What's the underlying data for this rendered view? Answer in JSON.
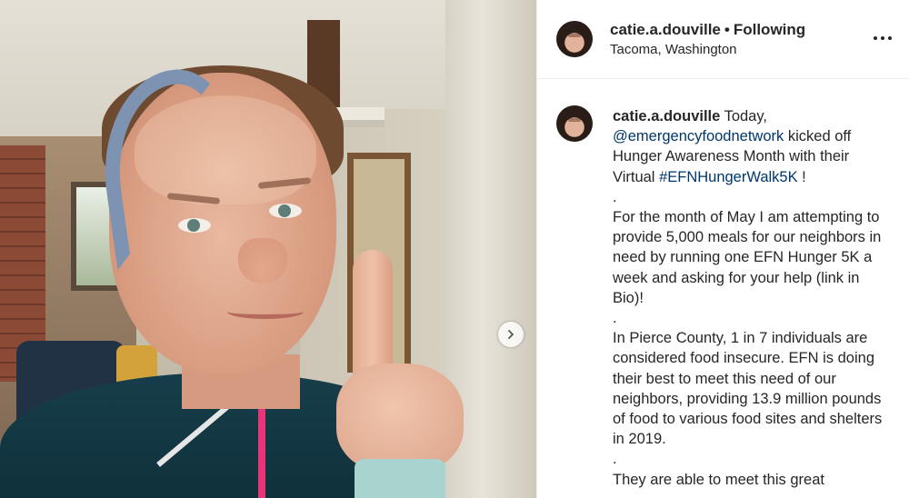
{
  "post": {
    "username": "catie.a.douville",
    "separator": "•",
    "follow_state": "Following",
    "location": "Tacoma, Washington"
  },
  "caption": {
    "username": "catie.a.douville",
    "line1_text": " Today,",
    "mention": "@emergencyfoodnetwork",
    "line2_text": " kicked off Hunger Awareness Month with their Virtual ",
    "hashtag": "#EFNHungerWalk5K",
    "line3_text": " !",
    "dot1": ".",
    "para2": "For the month of May I am attempting to provide 5,000 meals for our neighbors in need by running one EFN Hunger 5K a week and asking for your help (link in Bio)!",
    "dot2": ".",
    "para3": "In Pierce County, 1 in 7 individuals are considered food insecure. EFN is doing their best to meet this need of our neighbors, providing 13.9 million pounds of food to various food sites and shelters in 2019.",
    "dot3": ".",
    "para4": "They are able to meet this great"
  },
  "icons": {
    "more": "more-options-icon",
    "next": "chevron-right-icon"
  },
  "colors": {
    "link": "#00376b",
    "text": "#262626"
  }
}
